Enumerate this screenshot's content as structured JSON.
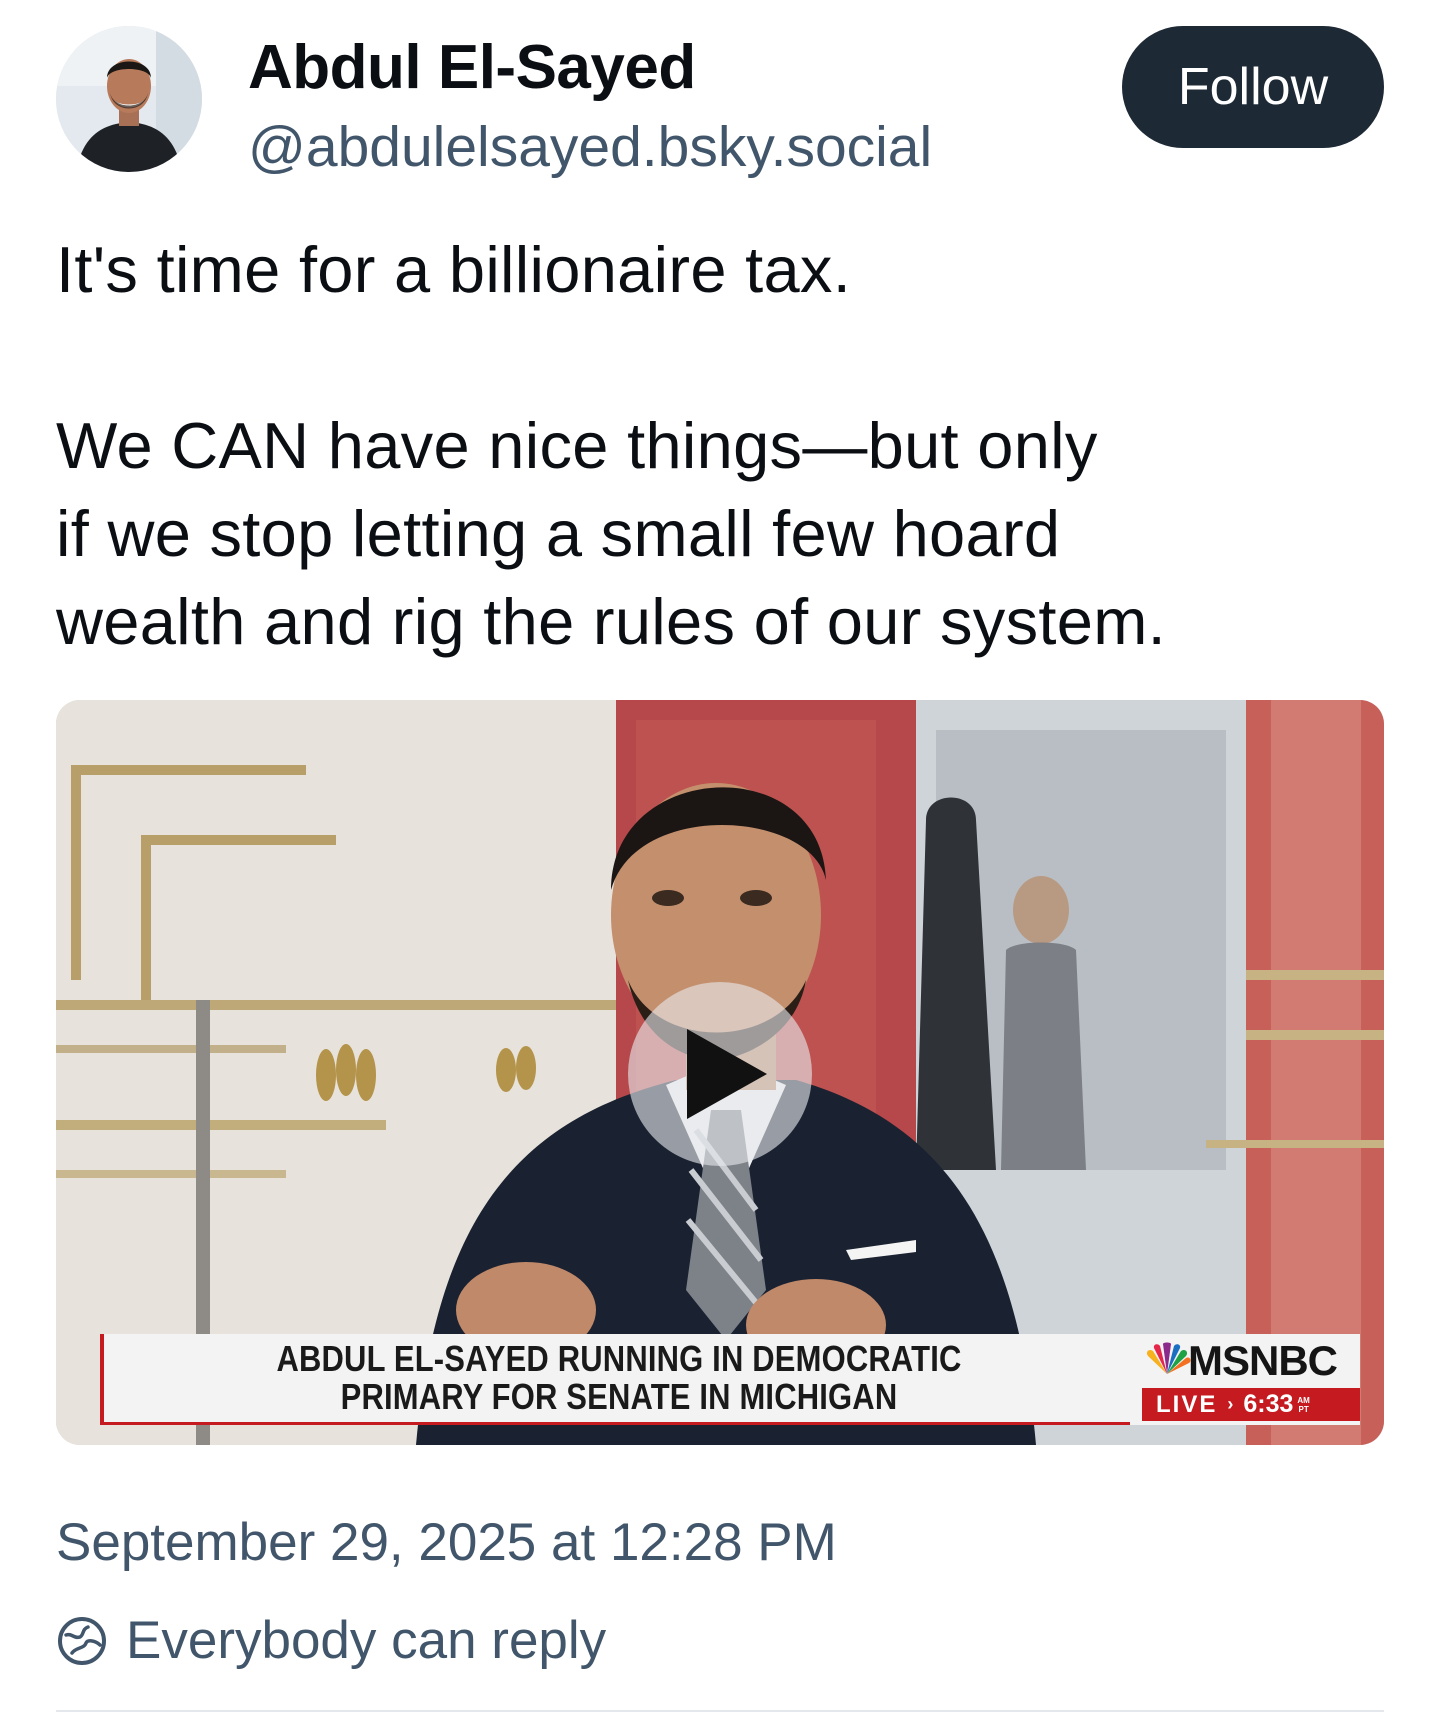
{
  "author": {
    "display_name": "Abdul El-Sayed",
    "handle": "@abdulelsayed.bsky.social",
    "avatar_icon": "profile-photo"
  },
  "follow_button": {
    "label": "Follow",
    "color": "#1d2935"
  },
  "post": {
    "paragraph_1": "It's time for a billionaire tax.",
    "paragraph_2_lines": [
      "We CAN have nice things—but only",
      "if we stop letting a small few hoard",
      "wealth and rig the rules of our system."
    ]
  },
  "video": {
    "play_icon": "play-icon",
    "chyron_lines": [
      "ABDUL EL-SAYED RUNNING IN DEMOCRATIC",
      "PRIMARY FOR SENATE IN MICHIGAN"
    ],
    "network_name": "MSNBC",
    "network_logo_icon": "peacock-logo-icon",
    "live_label": "LIVE",
    "live_arrow": "›",
    "live_time": "6:33",
    "live_ampm": [
      "AM",
      "PT"
    ],
    "accent_color": "#c41a20"
  },
  "timestamp": "September 29, 2025 at 12:28 PM",
  "reply_setting": {
    "icon": "globe-icon",
    "label": "Everybody can reply"
  },
  "colors": {
    "text_primary": "#0b0f14",
    "text_secondary": "#42566b"
  }
}
